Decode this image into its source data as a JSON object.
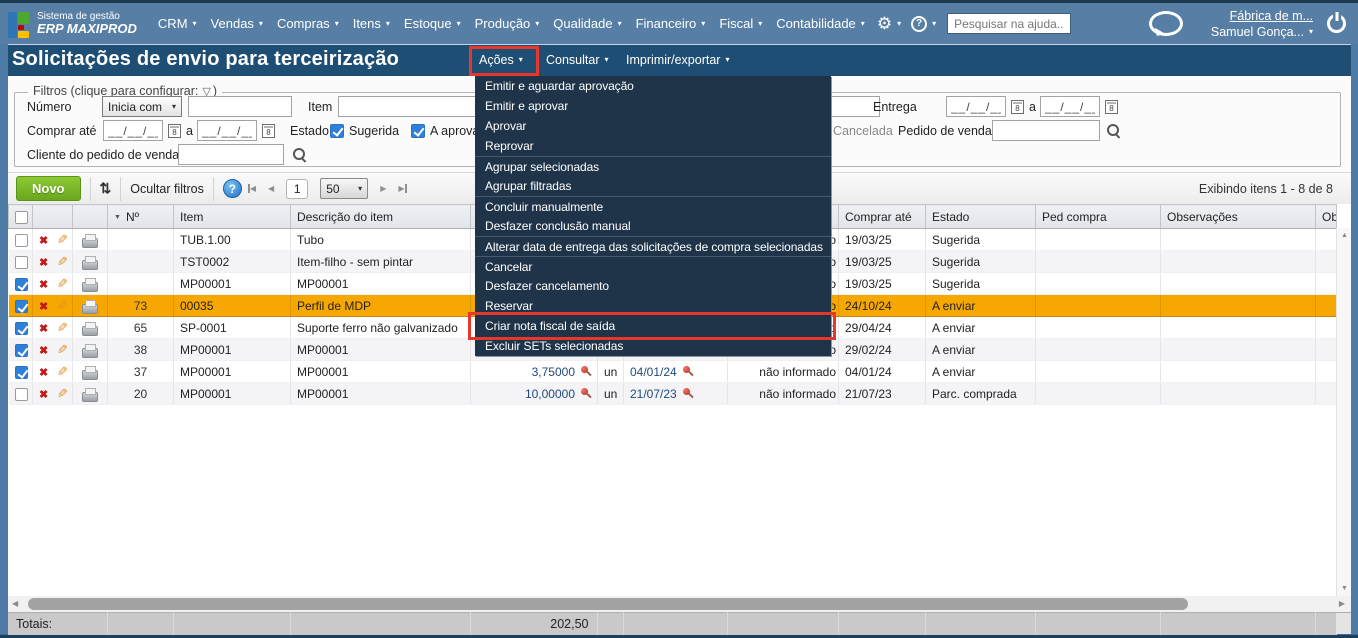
{
  "colors": {
    "topbar": "#577fa5",
    "titlebar": "#1f4e74",
    "menu_bg": "#203449",
    "annotation_red": "#e5372b",
    "selected_row": "#f7a800",
    "novo_green": "#76b62a",
    "checkbox_blue": "#2f80d9"
  },
  "topbar": {
    "logo_line1": "Sistema de gestão",
    "logo_line2": "ERP MAXIPROD",
    "menus": [
      "CRM",
      "Vendas",
      "Compras",
      "Itens",
      "Estoque",
      "Produção",
      "Qualidade",
      "Financeiro",
      "Fiscal",
      "Contabilidade"
    ],
    "search_placeholder": "Pesquisar na ajuda...",
    "account_link": "Fábrica de m...",
    "user_name": "Samuel Gonça..."
  },
  "titlebar": {
    "title": "Solicitações de envio para terceirização",
    "acoes_label": "Ações",
    "consultar_label": "Consultar",
    "imprimir_label": "Imprimir/exportar"
  },
  "actions_menu": {
    "items": [
      {
        "label": "Emitir e aguardar aprovação"
      },
      {
        "label": "Emitir e aprovar"
      },
      {
        "label": "Aprovar"
      },
      {
        "label": "Reprovar"
      },
      {
        "label": "Agrupar selecionadas",
        "section_start": true
      },
      {
        "label": "Agrupar filtradas"
      },
      {
        "label": "Concluir manualmente",
        "section_start": true
      },
      {
        "label": "Desfazer conclusão manual"
      },
      {
        "label": "Alterar data de entrega das solicitações de compra selecionadas",
        "section_start": true
      },
      {
        "label": "Cancelar",
        "section_start": true
      },
      {
        "label": "Desfazer cancelamento"
      },
      {
        "label": "Reservar"
      },
      {
        "label": "Criar nota fiscal de saída",
        "highlighted": true
      },
      {
        "label": "Excluir SETs selecionadas"
      }
    ]
  },
  "filters": {
    "legend": "Filtros (clique para configurar:",
    "legend_close": ")",
    "numero_label": "Número",
    "numero_operator": "Inicia com",
    "item_label": "Item",
    "entrega_label": "Entrega",
    "comprar_ate_label": "Comprar até",
    "range_sep": "a",
    "date_mask": "__/__/__",
    "estado_label": "Estado",
    "estado_options": [
      {
        "label": "Sugerida",
        "checked": true
      },
      {
        "label": "A aprovar",
        "checked": true
      },
      {
        "label": "",
        "checked": true
      }
    ],
    "cancelada_label": "Cancelada",
    "pedido_venda_label": "Pedido de venda",
    "cliente_label": "Cliente do pedido de venda"
  },
  "toolbar": {
    "novo_label": "Novo",
    "ocultar_label": "Ocultar filtros",
    "page": "1",
    "page_size": "50",
    "showing": "Exibindo itens 1 - 8 de 8"
  },
  "table": {
    "headers": {
      "num": "Nº",
      "item": "Item",
      "desc": "Descrição do item",
      "hidden_fragment": "o",
      "comprar": "Comprar até",
      "estado": "Estado",
      "ped": "Ped compra",
      "obs": "Observações",
      "obs2": "Obs"
    },
    "rows": [
      {
        "checked": false,
        "selected": false,
        "num": "",
        "item": "TUB.1.00",
        "desc": "Tubo",
        "qty": "",
        "qty_pin": false,
        "un": "",
        "entrega": "",
        "ent_pin": false,
        "fornecedor": "não informado",
        "comprar": "19/03/25",
        "estado": "Sugerida",
        "ped": "",
        "obs": ""
      },
      {
        "checked": false,
        "selected": false,
        "num": "",
        "item": "TST0002",
        "desc": "Item-filho - sem pintar",
        "qty": "",
        "qty_pin": false,
        "un": "",
        "entrega": "",
        "ent_pin": false,
        "fornecedor": "não informado",
        "comprar": "19/03/25",
        "estado": "Sugerida",
        "ped": "",
        "obs": ""
      },
      {
        "checked": true,
        "selected": false,
        "num": "",
        "item": "MP00001",
        "desc": "MP00001",
        "qty": "",
        "qty_pin": false,
        "un": "",
        "entrega": "",
        "ent_pin": false,
        "fornecedor": "não informado",
        "comprar": "19/03/25",
        "estado": "Sugerida",
        "ped": "",
        "obs": ""
      },
      {
        "checked": true,
        "selected": true,
        "num": "73",
        "item": "00035",
        "desc": "Perfil de MDP",
        "qty": "",
        "qty_pin": false,
        "un": "",
        "entrega": "",
        "ent_pin": false,
        "fornecedor": "não informado",
        "comprar": "24/10/24",
        "estado": "A enviar",
        "ped": "",
        "obs": ""
      },
      {
        "checked": true,
        "selected": false,
        "num": "65",
        "item": "SP-0001",
        "desc": "Suporte ferro não galvanizado",
        "qty": "",
        "qty_pin": false,
        "un": "",
        "entrega": "",
        "ent_pin": false,
        "fornecedor": "não informado",
        "comprar": "29/04/24",
        "estado": "A enviar",
        "ped": "",
        "obs": ""
      },
      {
        "checked": true,
        "selected": false,
        "num": "38",
        "item": "MP00001",
        "desc": "MP00001",
        "qty": "",
        "qty_pin": false,
        "un": "",
        "entrega": "",
        "ent_pin": false,
        "fornecedor": "não informado",
        "comprar": "29/02/24",
        "estado": "A enviar",
        "ped": "",
        "obs": ""
      },
      {
        "checked": true,
        "selected": false,
        "num": "37",
        "item": "MP00001",
        "desc": "MP00001",
        "qty": "3,75000",
        "qty_pin": true,
        "un": "un",
        "entrega": "04/01/24",
        "ent_pin": true,
        "fornecedor": "não informado",
        "comprar": "04/01/24",
        "estado": "A enviar",
        "ped": "",
        "obs": ""
      },
      {
        "checked": false,
        "selected": false,
        "num": "20",
        "item": "MP00001",
        "desc": "MP00001",
        "qty": "10,00000",
        "qty_pin": true,
        "un": "un",
        "entrega": "21/07/23",
        "ent_pin": true,
        "fornecedor": "não informado",
        "comprar": "21/07/23",
        "estado": "Parc. comprada",
        "ped": "",
        "obs": ""
      }
    ]
  },
  "totals": {
    "label": "Totais:",
    "qty_total": "202,50"
  }
}
